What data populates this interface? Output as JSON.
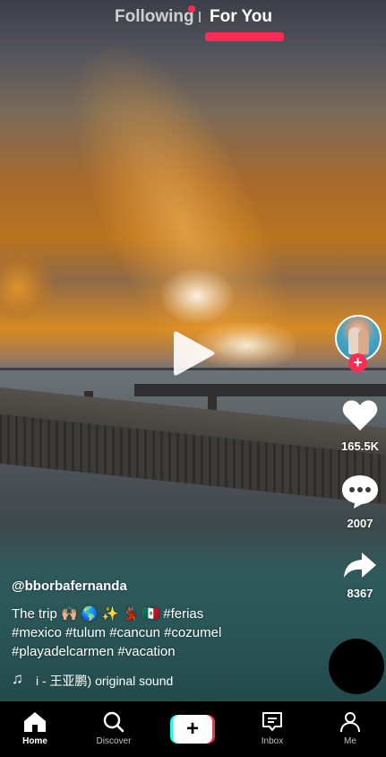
{
  "top_tabs": {
    "following": "Following",
    "for_you": "For You"
  },
  "colors": {
    "accent": "#fe2c55",
    "accent_cyan": "#25f4ee"
  },
  "video": {
    "state": "paused"
  },
  "creator": {
    "username": "@bborbafernanda"
  },
  "actions": {
    "likes": "165.5K",
    "comments": "2007",
    "shares": "8367"
  },
  "caption": {
    "lines": [
      "The trip 🙌🏼 🌎 ✨ 💃🏽 🇲🇽 #ferias",
      "#mexico #tulum #cancun #cozumel",
      "#playadelcarmen #vacation"
    ]
  },
  "sound": {
    "text": "i - 王亚鹏)    original sound"
  },
  "bottom_nav": {
    "home": "Home",
    "discover": "Discover",
    "create": "+",
    "inbox": "Inbox",
    "me": "Me"
  },
  "icons": {
    "play": "play-icon",
    "like": "heart-icon",
    "comment": "comment-bubble-icon",
    "share": "share-arrow-icon",
    "music": "music-note-icon"
  }
}
